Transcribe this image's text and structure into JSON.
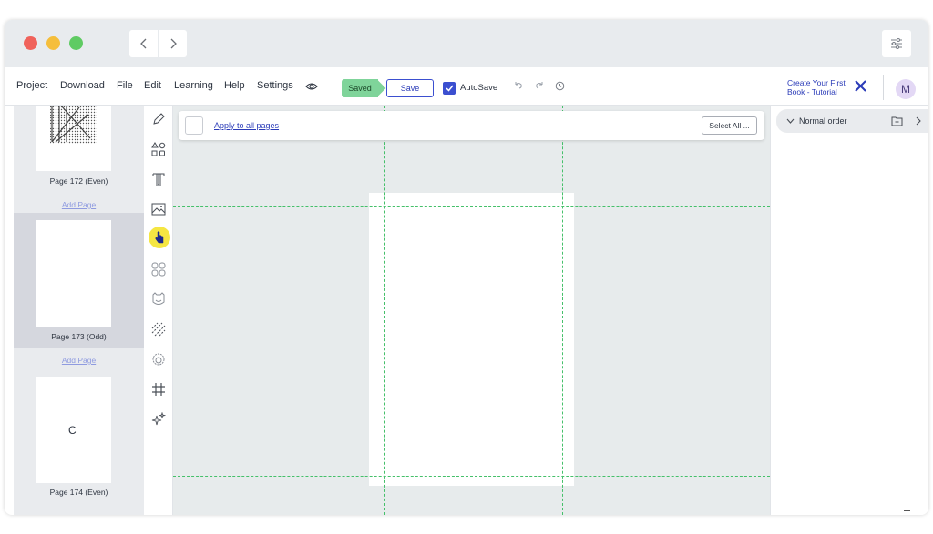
{
  "window": {
    "traffic_lights": {
      "close": "#f0625b",
      "minimize": "#f5be3b",
      "maximize": "#5fcb63"
    },
    "nav": {
      "back_icon": "chevron-left-icon",
      "forward_icon": "chevron-right-icon"
    }
  },
  "menubar": {
    "items": [
      "Project",
      "Download",
      "File",
      "Edit",
      "Learning",
      "Help",
      "Settings"
    ],
    "saved_label": "Saved",
    "save_label": "Save",
    "autosave_label": "AutoSave",
    "autosave_checked": true,
    "tutorial_label": "Create Your First Book - Tutorial",
    "avatar_initial": "M"
  },
  "pages_panel": {
    "pages": [
      {
        "label": "Page 172 (Even)"
      },
      {
        "label": "Page 173 (Odd)",
        "selected": true
      },
      {
        "label": "Page 174 (Even)"
      }
    ],
    "add_page_label": "Add Page",
    "loading_glyph": "C"
  },
  "toolbar": {
    "tools": [
      "pencil-icon",
      "shapes-icon",
      "text-icon",
      "image-icon",
      "pointer-icon",
      "elements-icon",
      "emoji-icon",
      "pattern-icon",
      "badge-icon",
      "grid-icon",
      "magic-icon"
    ],
    "highlight_color": "#f5e642"
  },
  "canvas": {
    "apply_label": "Apply to all pages",
    "select_all_label": "Select All ...",
    "guide_color": "#45c06a"
  },
  "right_panel": {
    "order_label": "Normal order"
  },
  "colors": {
    "accent": "#3b4fd0",
    "saved_green": "#7fd49a"
  }
}
